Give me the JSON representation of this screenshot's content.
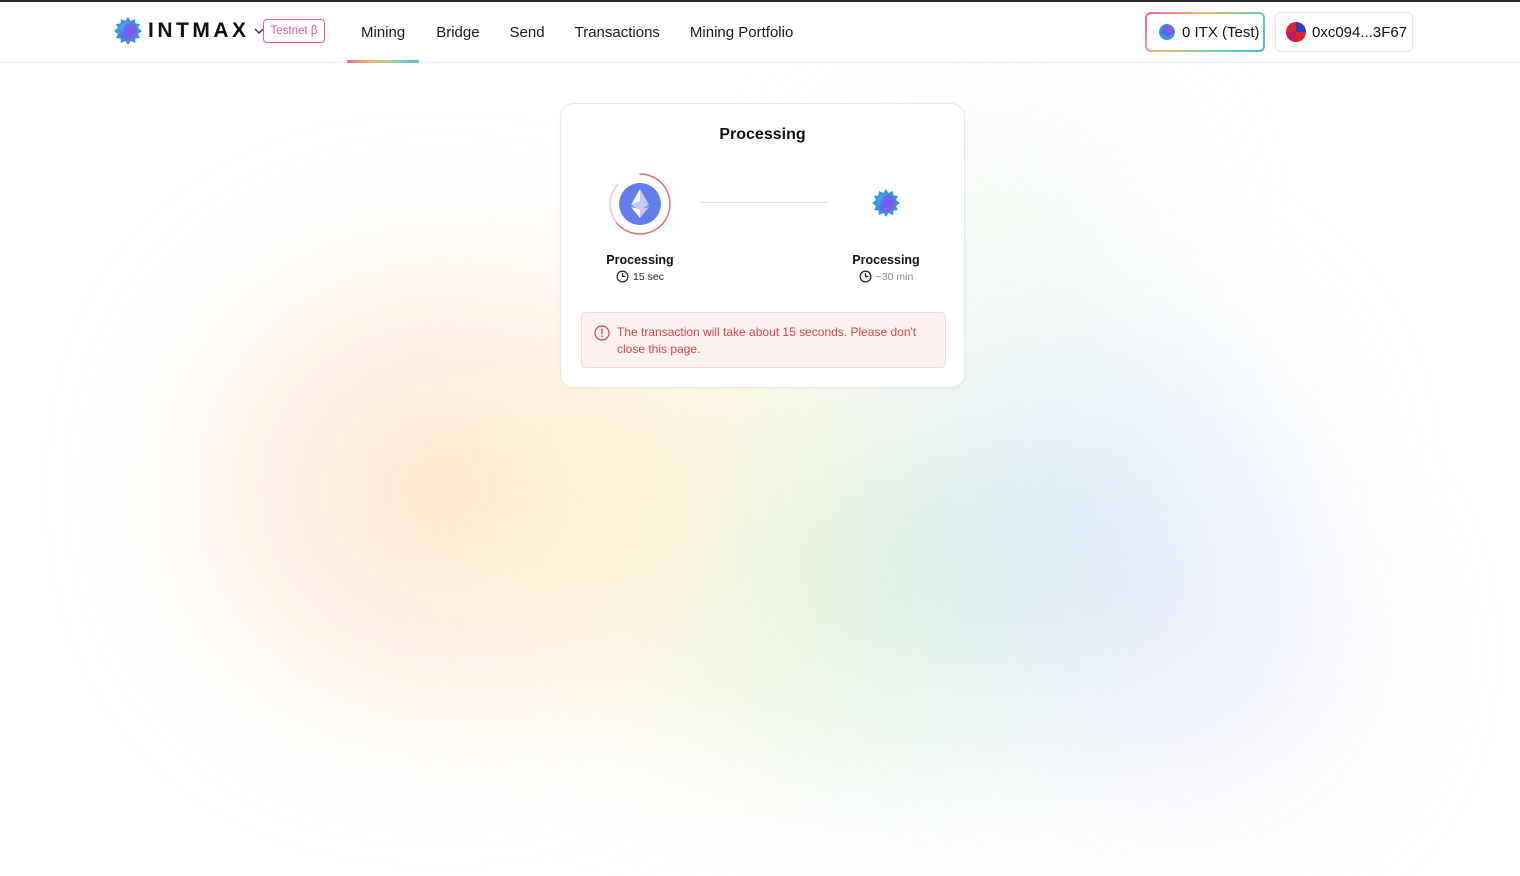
{
  "header": {
    "brand": "INTMAX",
    "badge": "Testnet β",
    "nav": [
      {
        "label": "Mining",
        "active": true
      },
      {
        "label": "Bridge",
        "active": false
      },
      {
        "label": "Send",
        "active": false
      },
      {
        "label": "Transactions",
        "active": false
      },
      {
        "label": "Mining Portfolio",
        "active": false
      }
    ],
    "balance": "0 ITX (Test)",
    "wallet": "0xc094...3F67"
  },
  "card": {
    "title": "Processing",
    "steps": [
      {
        "icon": "ethereum-icon",
        "label": "Processing",
        "time": "15 sec"
      },
      {
        "icon": "intmax-icon",
        "label": "Processing",
        "time": "~30 min"
      }
    ],
    "alert": "The transaction will take about 15 seconds. Please don't close this page."
  },
  "colors": {
    "accent_pink": "#e9579c",
    "alert_text": "#d04a40",
    "alert_bg": "#fdf2f1",
    "ethereum": "#627eea"
  }
}
